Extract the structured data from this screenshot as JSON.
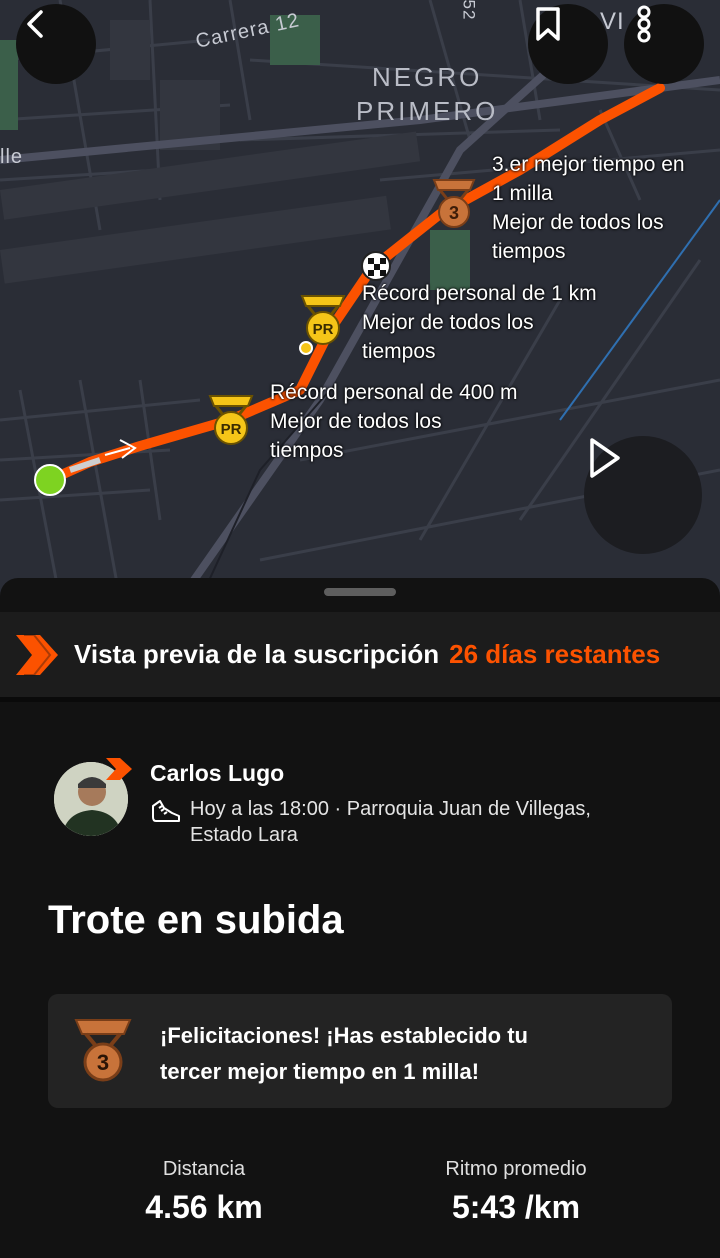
{
  "map": {
    "street_labels": [
      "Carrera 12",
      "lle",
      "52",
      "VI"
    ],
    "neighborhood": [
      "NEGRO",
      "PRIMERO"
    ],
    "annotations": [
      {
        "lines": [
          "3.er mejor tiempo en",
          "1 milla",
          "Mejor de todos los",
          "tiempos"
        ],
        "badge": "3"
      },
      {
        "lines": [
          "Récord personal de 1 km",
          "Mejor de todos los",
          "tiempos"
        ],
        "badge": "PR"
      },
      {
        "lines": [
          "Récord personal de 400 m",
          "Mejor de todos los",
          "tiempos"
        ],
        "badge": "PR"
      }
    ],
    "colors": {
      "route": "#fc5200",
      "start": "#7ed321",
      "pr_badge": "#f5c518",
      "bronze": "#c8733a"
    }
  },
  "buttons": {
    "back_icon": "chevron-left-icon",
    "bookmark_icon": "bookmark-icon",
    "more_icon": "more-vertical-icon",
    "play_icon": "play-icon"
  },
  "promo": {
    "text": "Vista previa de la suscripción",
    "days": "26 días restantes"
  },
  "athlete": {
    "name": "Carlos Lugo",
    "meta_line1": "Hoy a las 18:00 · Parroquia Juan de Villegas,",
    "meta_line2": "Estado Lara"
  },
  "activity": {
    "title": "Trote en subida"
  },
  "congrats": {
    "badge": "3",
    "line1": "¡Felicitaciones! ¡Has establecido tu",
    "line2": "tercer mejor tiempo en 1 milla!"
  },
  "stats": [
    {
      "label": "Distancia",
      "value": "4.56 km"
    },
    {
      "label": "Ritmo promedio",
      "value": "5:43 /km"
    }
  ]
}
